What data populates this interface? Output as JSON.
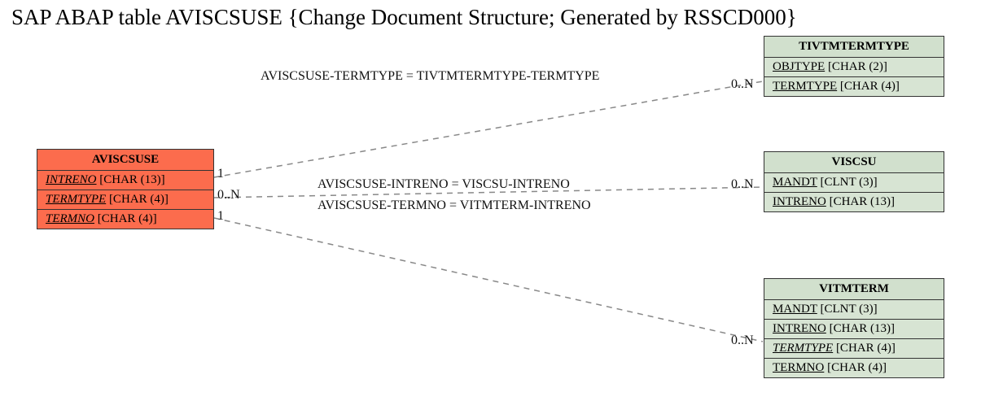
{
  "title": "SAP ABAP table AVISCSUSE {Change Document Structure; Generated by RSSCD000}",
  "entities": {
    "aviscsuse": {
      "name": "AVISCSUSE",
      "rows": [
        {
          "field": "INTRENO",
          "type": "[CHAR (13)]"
        },
        {
          "field": "TERMTYPE",
          "type": "[CHAR (4)]"
        },
        {
          "field": "TERMNO",
          "type": "[CHAR (4)]"
        }
      ]
    },
    "tivtmtermtype": {
      "name": "TIVTMTERMTYPE",
      "rows": [
        {
          "field": "OBJTYPE",
          "type": "[CHAR (2)]"
        },
        {
          "field": "TERMTYPE",
          "type": "[CHAR (4)]"
        }
      ]
    },
    "viscsu": {
      "name": "VISCSU",
      "rows": [
        {
          "field": "MANDT",
          "type": "[CLNT (3)]"
        },
        {
          "field": "INTRENO",
          "type": "[CHAR (13)]"
        }
      ]
    },
    "vitmterm": {
      "name": "VITMTERM",
      "rows": [
        {
          "field": "MANDT",
          "type": "[CLNT (3)]"
        },
        {
          "field": "INTRENO",
          "type": "[CHAR (13)]"
        },
        {
          "field": "TERMTYPE",
          "type": "[CHAR (4)]"
        },
        {
          "field": "TERMNO",
          "type": "[CHAR (4)]"
        }
      ]
    }
  },
  "relations": {
    "r1": "AVISCSUSE-TERMTYPE = TIVTMTERMTYPE-TERMTYPE",
    "r2": "AVISCSUSE-INTRENO = VISCSU-INTRENO",
    "r3": "AVISCSUSE-TERMNO = VITMTERM-INTRENO"
  },
  "cardinality": {
    "one": "1",
    "zeroN": "0..N"
  }
}
